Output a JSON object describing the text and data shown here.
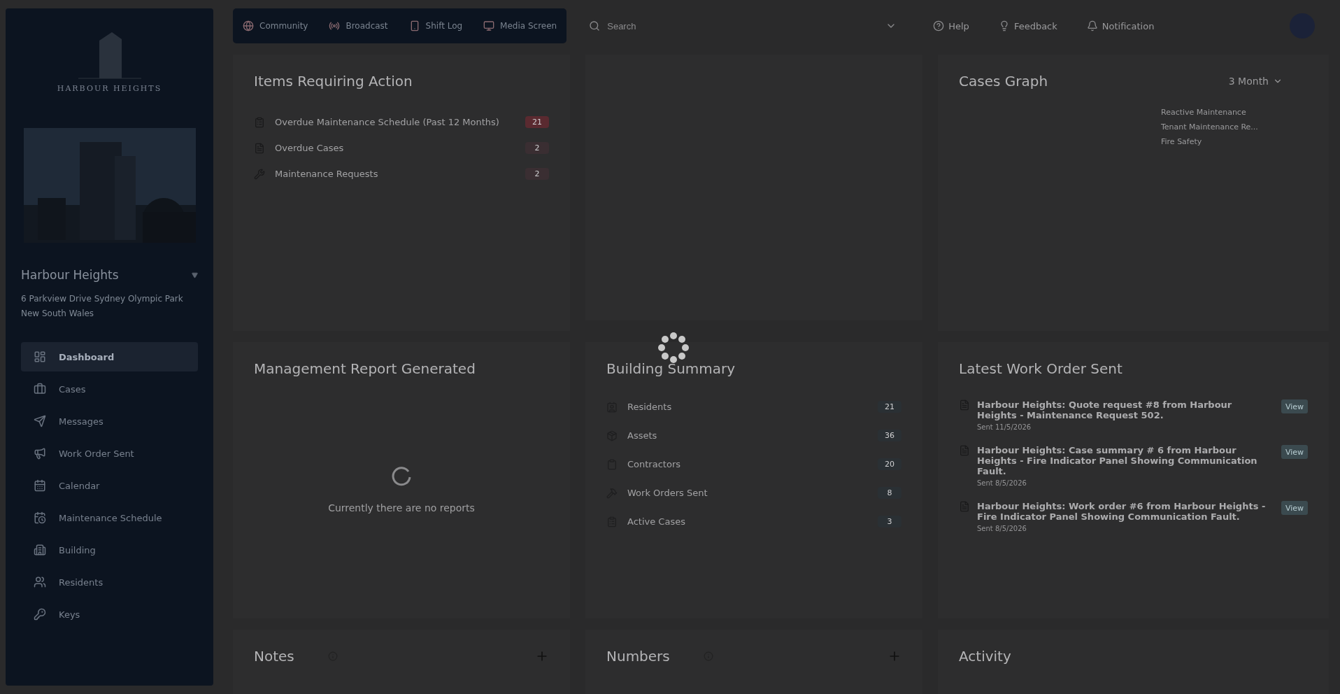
{
  "sidebar": {
    "logo_text": "HARBOUR HEIGHTS",
    "building_name": "Harbour Heights",
    "address": "6 Parkview Drive Sydney Olympic Park New South Wales",
    "items": [
      {
        "label": "Dashboard",
        "selected": true
      },
      {
        "label": "Cases",
        "selected": false
      },
      {
        "label": "Messages",
        "selected": false
      },
      {
        "label": "Work Order Sent",
        "selected": false
      },
      {
        "label": "Calendar",
        "selected": false
      },
      {
        "label": "Maintenance Schedule",
        "selected": false
      },
      {
        "label": "Building",
        "selected": false
      },
      {
        "label": "Residents",
        "selected": false
      },
      {
        "label": "Keys",
        "selected": false
      }
    ]
  },
  "topnav": [
    {
      "label": "Community"
    },
    {
      "label": "Broadcast"
    },
    {
      "label": "Shift Log"
    },
    {
      "label": "Media Screen"
    }
  ],
  "search": {
    "placeholder": "Search"
  },
  "header_actions": [
    {
      "label": "Help"
    },
    {
      "label": "Feedback"
    },
    {
      "label": "Notification"
    }
  ],
  "items_requiring_action": {
    "title": "Items Requiring Action",
    "rows": [
      {
        "label": "Overdue Maintenance Schedule (Past 12 Months)",
        "count": "21",
        "color": "#5a2a30"
      },
      {
        "label": "Overdue Cases",
        "count": "2",
        "color": "#3a2e32"
      },
      {
        "label": "Maintenance Requests",
        "count": "2",
        "color": "#3a2e32"
      }
    ]
  },
  "cases_graph": {
    "title": "Cases Graph",
    "period": "3 Month",
    "legend": [
      "Reactive Maintenance",
      "Tenant Maintenance Re...",
      "Fire Safety"
    ]
  },
  "management_report": {
    "title": "Management Report Generated",
    "empty_text": "Currently there are no reports"
  },
  "building_summary": {
    "title": "Building Summary",
    "rows": [
      {
        "label": "Residents",
        "count": "21"
      },
      {
        "label": "Assets",
        "count": "36"
      },
      {
        "label": "Contractors",
        "count": "20"
      },
      {
        "label": "Work Orders Sent",
        "count": "8"
      },
      {
        "label": "Active Cases",
        "count": "3"
      }
    ]
  },
  "latest_work_orders": {
    "title": "Latest Work Order Sent",
    "items": [
      {
        "title": "Harbour Heights: Quote request #8 from Harbour Heights - Maintenance Request 502.",
        "date": "Sent 11/5/2026",
        "action": "View"
      },
      {
        "title": "Harbour Heights: Case summary # 6 from Harbour Heights - Fire Indicator Panel Showing Communication Fault.",
        "date": "Sent 8/5/2026",
        "action": "View"
      },
      {
        "title": "Harbour Heights: Work order #6 from Harbour Heights - Fire Indicator Panel Showing Communication Fault.",
        "date": "Sent 8/5/2026",
        "action": "View"
      }
    ]
  },
  "notes": {
    "title": "Notes"
  },
  "numbers": {
    "title": "Numbers"
  },
  "activity": {
    "title": "Activity"
  }
}
